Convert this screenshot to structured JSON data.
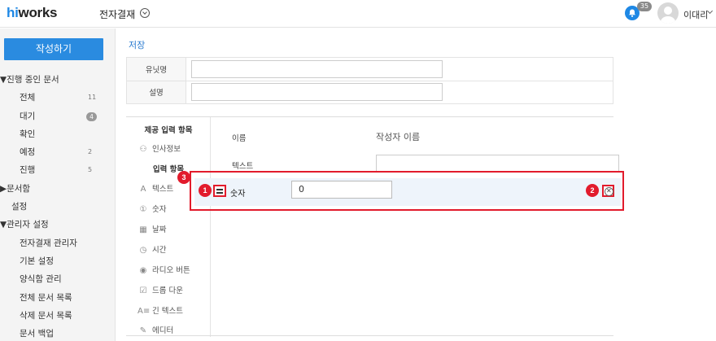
{
  "header": {
    "logo_hi": "hi",
    "logo_rest": "works",
    "app_title": "전자결재",
    "notification_count": "35",
    "user_name": "이대리"
  },
  "sidebar": {
    "compose_label": "작성하기",
    "items": [
      {
        "label": "진행 중인 문서",
        "type": "section",
        "caret": "▼"
      },
      {
        "label": "전체",
        "type": "sub",
        "count": "11"
      },
      {
        "label": "대기",
        "type": "sub",
        "count": "4",
        "pill": true
      },
      {
        "label": "확인",
        "type": "sub"
      },
      {
        "label": "예정",
        "type": "sub",
        "count": "2"
      },
      {
        "label": "진행",
        "type": "sub",
        "count": "5"
      },
      {
        "label": "문서함",
        "type": "section",
        "caret": "▶"
      },
      {
        "label": "설정",
        "type": "plain"
      },
      {
        "label": "관리자 설정",
        "type": "section",
        "caret": "▼"
      },
      {
        "label": "전자결재 관리자",
        "type": "sub"
      },
      {
        "label": "기본 설정",
        "type": "sub"
      },
      {
        "label": "양식함 관리",
        "type": "sub"
      },
      {
        "label": "전체 문서 목록",
        "type": "sub"
      },
      {
        "label": "삭제 문서 목록",
        "type": "sub"
      },
      {
        "label": "문서 백업",
        "type": "sub"
      }
    ]
  },
  "content": {
    "save_label": "저장",
    "info_rows": [
      {
        "label": "유닛명",
        "value": ""
      },
      {
        "label": "설명",
        "value": ""
      }
    ]
  },
  "palette": {
    "provided_title": "제공 입력 항목",
    "provided_items": [
      {
        "label": "인사정보",
        "icon": "people-icon",
        "glyph": "⚇"
      }
    ],
    "input_title": "입력 항목",
    "input_items": [
      {
        "label": "텍스트",
        "icon": "text-icon",
        "glyph": "A"
      },
      {
        "label": "숫자",
        "icon": "number-icon",
        "glyph": "①"
      },
      {
        "label": "날짜",
        "icon": "calendar-icon",
        "glyph": "▦"
      },
      {
        "label": "시간",
        "icon": "clock-icon",
        "glyph": "◷"
      },
      {
        "label": "라디오 버튼",
        "icon": "radio-icon",
        "glyph": "◉"
      },
      {
        "label": "드롭 다운",
        "icon": "dropdown-icon",
        "glyph": "☑"
      },
      {
        "label": "긴 텍스트",
        "icon": "long-text-icon",
        "glyph": "A≡"
      },
      {
        "label": "에디터",
        "icon": "editor-icon",
        "glyph": "✎"
      }
    ]
  },
  "form": {
    "name_label": "이름",
    "name_value": "작성자 이름",
    "text_label": "텍스트",
    "text_value": "",
    "number_label": "숫자",
    "number_value": "0"
  },
  "markers": [
    "1",
    "2",
    "3"
  ],
  "colors": {
    "accent": "#2a8be0",
    "highlight": "#e21b2c",
    "selected_row": "#eef4fb"
  }
}
